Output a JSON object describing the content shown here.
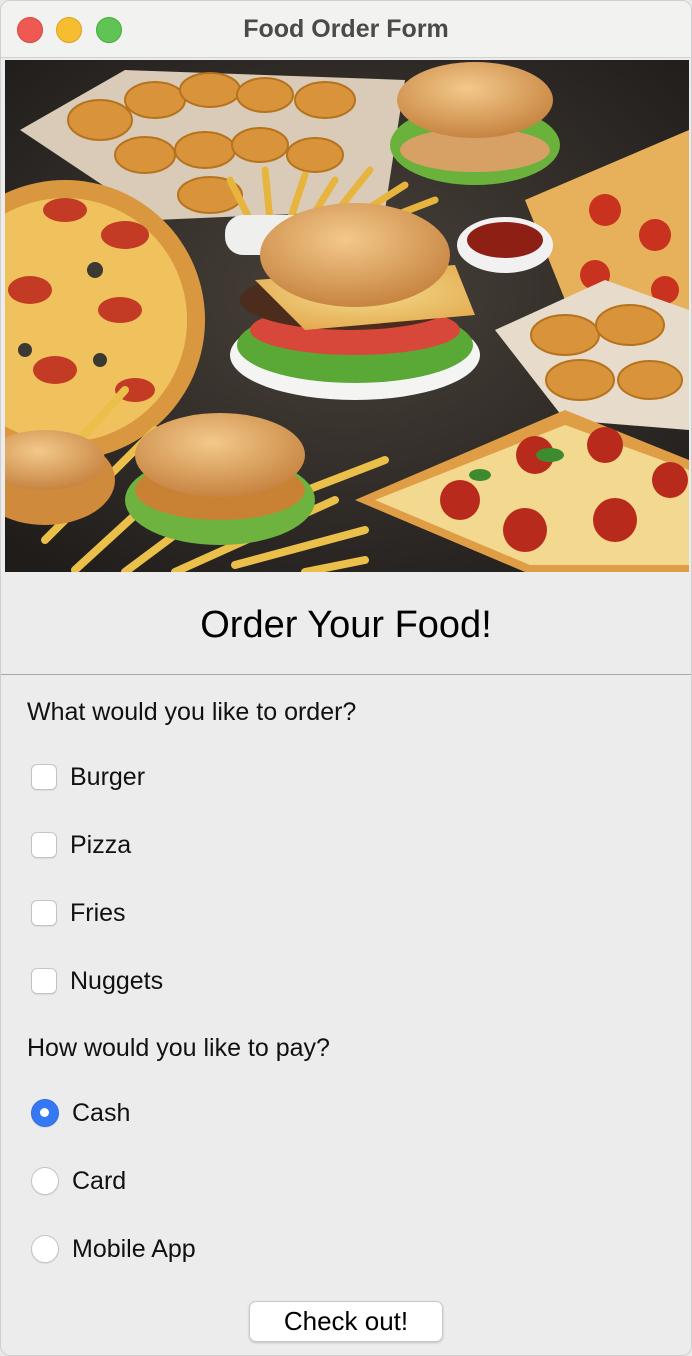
{
  "window": {
    "title": "Food Order Form"
  },
  "hero": {
    "icon": "food-photo"
  },
  "heading": "Order Your Food!",
  "order": {
    "prompt": "What would you like to order?",
    "items": [
      {
        "label": "Burger",
        "checked": false
      },
      {
        "label": "Pizza",
        "checked": false
      },
      {
        "label": "Fries",
        "checked": false
      },
      {
        "label": "Nuggets",
        "checked": false
      }
    ]
  },
  "payment": {
    "prompt": "How would you like to pay?",
    "options": [
      {
        "label": "Cash",
        "selected": true
      },
      {
        "label": "Card",
        "selected": false
      },
      {
        "label": "Mobile App",
        "selected": false
      }
    ]
  },
  "checkout_label": "Check out!",
  "colors": {
    "accent": "#3478f6",
    "window_bg": "#ececec"
  }
}
